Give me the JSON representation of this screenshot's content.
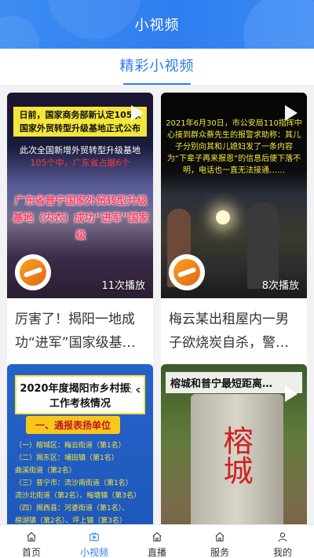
{
  "header": {
    "title": "小视频"
  },
  "subtabs": {
    "active": "精彩小视频"
  },
  "cards": [
    {
      "caption": "厉害了！揭阳一地成功“进军”国家级基…",
      "views": "11次播放",
      "thumb_text_1": "日前，国家商务部新认定105家国家外贸转型升级基地正式公布",
      "thumb_text_2a": "此次全国新增外贸转型升级基地",
      "thumb_text_2b": "105个中，广东省占据6个",
      "thumb_text_3": "广东省普宁国家外贸转型升级基地（内衣）成功“进军”国家级"
    },
    {
      "caption": "梅云某出租屋内一男子欲烧炭自杀，警…",
      "views": "8次播放",
      "thumb_text": "2021年6月30日，市公安局110指挥中心接到群众蔡先生的报警求助称：其儿子分别向其和儿媳妇发了一条内容为“下辈子再来报恩”的信息后便下落不明，电话也一直无法接通……"
    },
    {
      "caption": "",
      "banner": "2020年度揭阳市乡村振兴工作考核情况",
      "sub_banner": "一、通报表扬单位",
      "lines": [
        "（一）榕城区：梅云街道（第1名）",
        "（二）揭东区：埔田镇（第1名）",
        "曲溪街道（第2名）",
        "（三）普宁市：流沙南街道（第1名）",
        "流沙北街道（第2名）、梅塘镇（第3名）",
        "（四）揭西县：河婆街道（第1名）、",
        "棉湖镇（第2名）、坪上镇（第3名）"
      ]
    },
    {
      "caption": "",
      "banner": "榕城和普宁最短距离…",
      "stone_text": "榕城"
    }
  ],
  "tabbar": [
    {
      "label": "首页",
      "icon": "home-icon"
    },
    {
      "label": "小视频",
      "icon": "video-icon",
      "active": true
    },
    {
      "label": "直播",
      "icon": "live-icon"
    },
    {
      "label": "服务",
      "icon": "service-icon"
    },
    {
      "label": "我的",
      "icon": "profile-icon"
    }
  ],
  "colors": {
    "accent": "#2d7cf0",
    "header_bg": "#3c8cf2"
  }
}
